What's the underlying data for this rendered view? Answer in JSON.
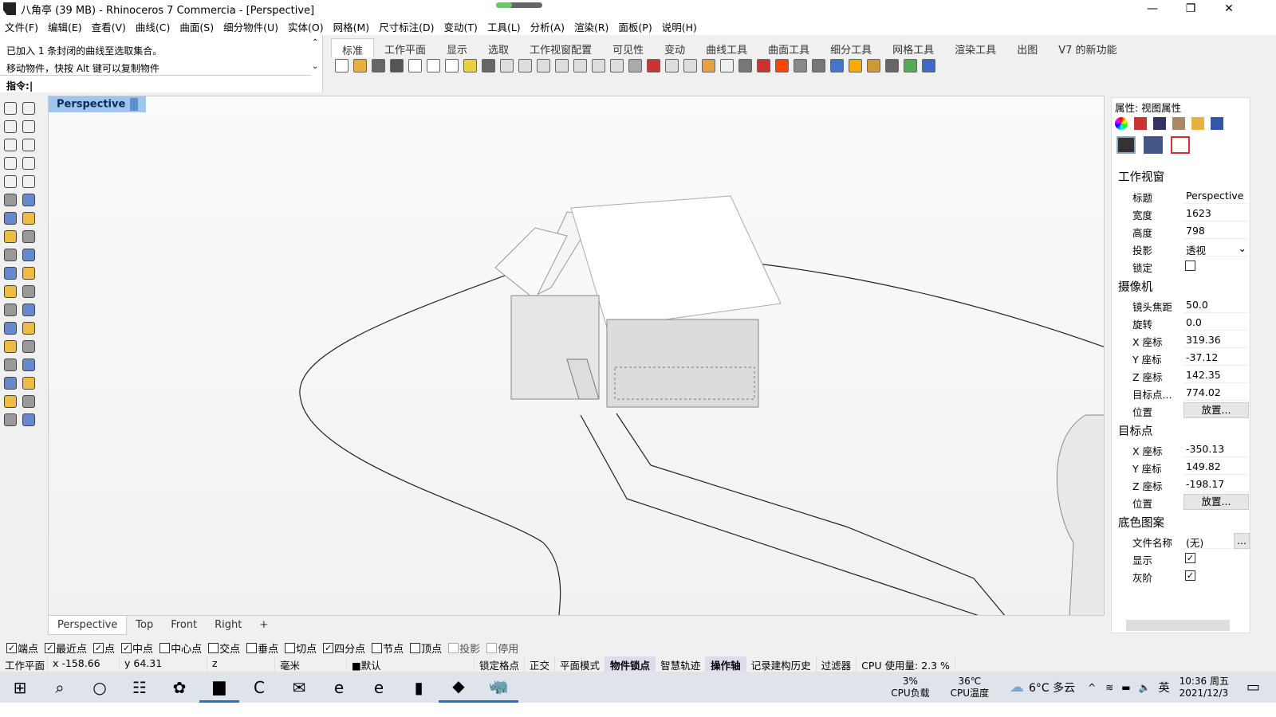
{
  "window": {
    "title": "八角亭 (39 MB) - Rhinoceros 7 Commercia - [Perspective]",
    "progress_percent": 35
  },
  "menu": [
    "文件(F)",
    "编辑(E)",
    "查看(V)",
    "曲线(C)",
    "曲面(S)",
    "细分物件(U)",
    "实体(O)",
    "网格(M)",
    "尺寸标注(D)",
    "变动(T)",
    "工具(L)",
    "分析(A)",
    "渲染(R)",
    "面板(P)",
    "说明(H)"
  ],
  "command": {
    "history": [
      "已加入 1 条封闭的曲线至选取集合。",
      "移动物件，快按 Alt 键可以复制物件"
    ],
    "prompt": "指令:"
  },
  "toolbar_tabs": [
    {
      "label": "标准",
      "active": true
    },
    {
      "label": "工作平面"
    },
    {
      "label": "显示"
    },
    {
      "label": "选取"
    },
    {
      "label": "工作视窗配置"
    },
    {
      "label": "可见性"
    },
    {
      "label": "变动"
    },
    {
      "label": "曲线工具"
    },
    {
      "label": "曲面工具"
    },
    {
      "label": "细分工具"
    },
    {
      "label": "网格工具"
    },
    {
      "label": "渲染工具"
    },
    {
      "label": "出图"
    },
    {
      "label": "V7 的新功能"
    }
  ],
  "viewport": {
    "title": "Perspective",
    "tabs": [
      {
        "label": "Perspective",
        "active": true
      },
      {
        "label": "Top"
      },
      {
        "label": "Front"
      },
      {
        "label": "Right"
      },
      {
        "label": "+"
      }
    ]
  },
  "panel": {
    "title": "属性: 视图属性",
    "sections": {
      "viewport": "工作视窗",
      "camera": "摄像机",
      "target": "目标点",
      "wallpaper": "底色图案"
    },
    "viewport": {
      "title_label": "标题",
      "title": "Perspective",
      "width_label": "宽度",
      "width": "1623",
      "height_label": "高度",
      "height": "798",
      "projection_label": "投影",
      "projection": "透视",
      "lock_label": "锁定",
      "lock": false
    },
    "camera": {
      "lens_label": "镜头焦距",
      "lens": "50.0",
      "rotate_label": "旋转",
      "rotate": "0.0",
      "x_label": "X 座标",
      "x": "319.36",
      "y_label": "Y 座标",
      "y": "-37.12",
      "z_label": "Z 座标",
      "z": "142.35",
      "dist_label": "目标点...",
      "dist": "774.02",
      "pos_label": "位置",
      "place": "放置..."
    },
    "target": {
      "x_label": "X 座标",
      "x": "-350.13",
      "y_label": "Y 座标",
      "y": "149.82",
      "z_label": "Z 座标",
      "z": "-198.17",
      "pos_label": "位置",
      "place": "放置..."
    },
    "wallpaper": {
      "file_label": "文件名称",
      "file": "(无)",
      "browse": "...",
      "show_label": "显示",
      "show": true,
      "gray_label": "灰阶",
      "gray": true
    }
  },
  "osnap": [
    {
      "label": "端点",
      "checked": true
    },
    {
      "label": "最近点",
      "checked": true
    },
    {
      "label": "点",
      "checked": true
    },
    {
      "label": "中点",
      "checked": true
    },
    {
      "label": "中心点",
      "checked": false
    },
    {
      "label": "交点",
      "checked": false
    },
    {
      "label": "垂点",
      "checked": false
    },
    {
      "label": "切点",
      "checked": false
    },
    {
      "label": "四分点",
      "checked": true
    },
    {
      "label": "节点",
      "checked": false
    },
    {
      "label": "顶点",
      "checked": false
    },
    {
      "label": "投影",
      "checked": false,
      "disabled": true
    },
    {
      "label": "停用",
      "checked": false,
      "disabled": true
    }
  ],
  "status": [
    {
      "label": "工作平面"
    },
    {
      "label": "x -158.66"
    },
    {
      "label": "y 64.31"
    },
    {
      "label": "z"
    },
    {
      "label": "毫米"
    },
    {
      "label": "■默认"
    },
    {
      "label": "锁定格点"
    },
    {
      "label": "正交"
    },
    {
      "label": "平面模式"
    },
    {
      "label": "物件锁点",
      "on": true
    },
    {
      "label": "智慧轨迹"
    },
    {
      "label": "操作轴",
      "on": true
    },
    {
      "label": "记录建构历史"
    },
    {
      "label": "过滤器"
    },
    {
      "label": "CPU 使用量: 2.3 %"
    }
  ],
  "taskbar": {
    "apps": [
      "start-icon",
      "search-icon",
      "cortana-icon",
      "taskview-icon",
      "app-icon",
      "explorer-icon",
      "app-c-icon",
      "mail-icon",
      "edge-icon",
      "browser-e-icon",
      "office-icon",
      "app-flame-icon",
      "rhino-icon"
    ],
    "cpu_load": "3%",
    "cpu_load_label": "CPU负载",
    "cpu_temp": "36℃",
    "cpu_temp_label": "CPU温度",
    "weather": "6°C 多云",
    "ime": "英",
    "time": "10:36 周五",
    "date": "2021/12/3"
  }
}
